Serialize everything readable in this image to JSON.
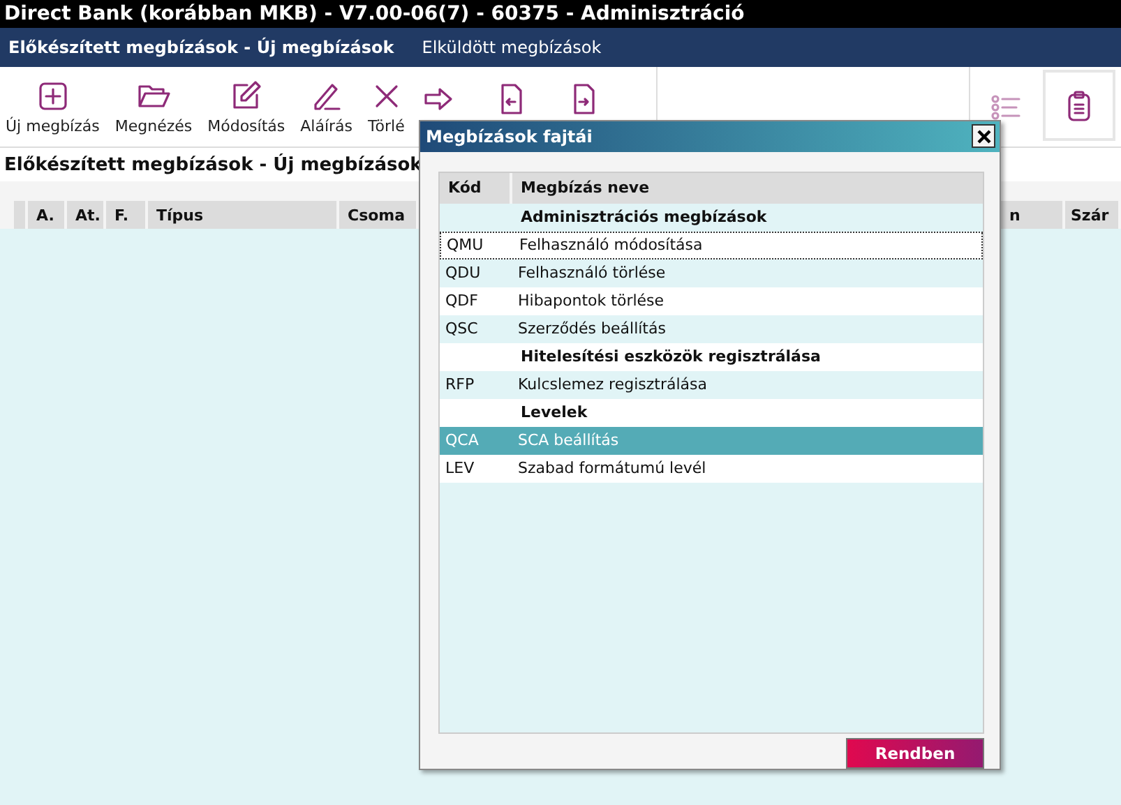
{
  "window": {
    "title": "Direct Bank (korábban MKB) - V7.00-06(7) - 60375 - Adminisztráció"
  },
  "nav_tabs": [
    {
      "label": "Előkészített megbízások - Új megbízások",
      "selected": true
    },
    {
      "label": "Elküldött megbízások",
      "selected": false
    }
  ],
  "toolbar": [
    {
      "kind": "plus",
      "label": "Új megbízás"
    },
    {
      "kind": "folder",
      "label": "Megnézés"
    },
    {
      "kind": "edit",
      "label": "Módosítás"
    },
    {
      "kind": "pen",
      "label": "Aláírás"
    },
    {
      "kind": "cross",
      "label": "Törlé"
    },
    {
      "kind": "arrow"
    },
    {
      "kind": "doc-in"
    },
    {
      "kind": "doc-out"
    }
  ],
  "toolbar_right": [
    {
      "kind": "list",
      "selected": false
    },
    {
      "kind": "clipboard",
      "selected": true
    }
  ],
  "breadcrumb": "Előkészített megbízások - Új megbízások",
  "table": {
    "columns": [
      "A.",
      "At.",
      "F.",
      "Típus",
      "Csoma",
      "n",
      "Szár"
    ]
  },
  "dialog": {
    "title": "Megbízások fajtái",
    "columns": [
      "Kód",
      "Megbízás neve"
    ],
    "rows": [
      {
        "kind": "group",
        "name": "Adminisztrációs megbízások"
      },
      {
        "kind": "item",
        "code": "QMU",
        "name": "Felhasználó módosítása",
        "selected": false,
        "focused": true
      },
      {
        "kind": "item",
        "code": "QDU",
        "name": "Felhasználó törlése",
        "selected": false,
        "focused": false
      },
      {
        "kind": "item",
        "code": "QDF",
        "name": "Hibapontok törlése",
        "selected": false,
        "focused": false
      },
      {
        "kind": "item",
        "code": "QSC",
        "name": "Szerződés beállítás",
        "selected": false,
        "focused": false
      },
      {
        "kind": "group",
        "name": "Hitelesítési eszközök regisztrálása"
      },
      {
        "kind": "item",
        "code": "RFP",
        "name": "Kulcslemez regisztrálása",
        "selected": false,
        "focused": false
      },
      {
        "kind": "group",
        "name": "Levelek"
      },
      {
        "kind": "item",
        "code": "QCA",
        "name": "SCA beállítás",
        "selected": true,
        "focused": false
      },
      {
        "kind": "item",
        "code": "LEV",
        "name": "Szabad formátumú levél",
        "selected": false,
        "focused": false
      }
    ],
    "ok_button": "Rendben"
  }
}
